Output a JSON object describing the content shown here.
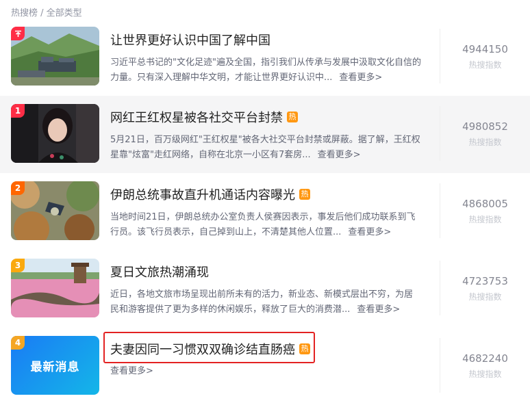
{
  "breadcrumb": "热搜榜 / 全部类型",
  "hot_badge": "热",
  "more_label": "查看更多>",
  "metric_label": "热搜指数",
  "colors": {
    "top": "#ff2d46",
    "rank1": "#fe2d46",
    "rank2": "#ff6600",
    "rank3": "#faa90e",
    "rank4": "#f5a623",
    "hot": "#ff9812",
    "highlight_box": "#e32121"
  },
  "items": [
    {
      "rank": "",
      "pinned": true,
      "title": "让世界更好认识中国了解中国",
      "hot": false,
      "desc": "习近平总书记的\"文化足迹\"遍及全国，指引我们从传承与发展中汲取文化自信的力量。只有深入理解中华文明，才能让世界更好认识中...",
      "index": "4944150",
      "thumb": "landscape-buildings"
    },
    {
      "rank": "1",
      "title": "网红王红权星被各社交平台封禁",
      "hot": true,
      "desc": "5月21日，百万级网红\"王红权星\"被各大社交平台封禁或屏蔽。据了解，王红权星靠\"炫富\"走红网络，自称在北京一小区有7套房...",
      "index": "4980852",
      "thumb": "portrait"
    },
    {
      "rank": "2",
      "title": "伊朗总统事故直升机通话内容曝光",
      "hot": true,
      "desc": "当地时间21日，伊朗总统办公室负责人侯赛因表示，事发后他们成功联系到飞行员。该飞行员表示，自己掉到山上，不清楚其他人位置...",
      "index": "4868005",
      "thumb": "mountain-wreck"
    },
    {
      "rank": "3",
      "title": "夏日文旅热潮涌现",
      "hot": false,
      "desc": "近日，各地文旅市场呈现出前所未有的活力，新业态、新模式层出不穷，为居民和游客提供了更为多样的休闲娱乐，释放了巨大的消费潜...",
      "index": "4723753",
      "thumb": "flower-field"
    },
    {
      "rank": "4",
      "title": "夫妻因同一习惯双双确诊结直肠癌",
      "hot": true,
      "desc": "",
      "index": "4682240",
      "thumb": "latest-news",
      "thumb_text": "最新消息"
    }
  ]
}
